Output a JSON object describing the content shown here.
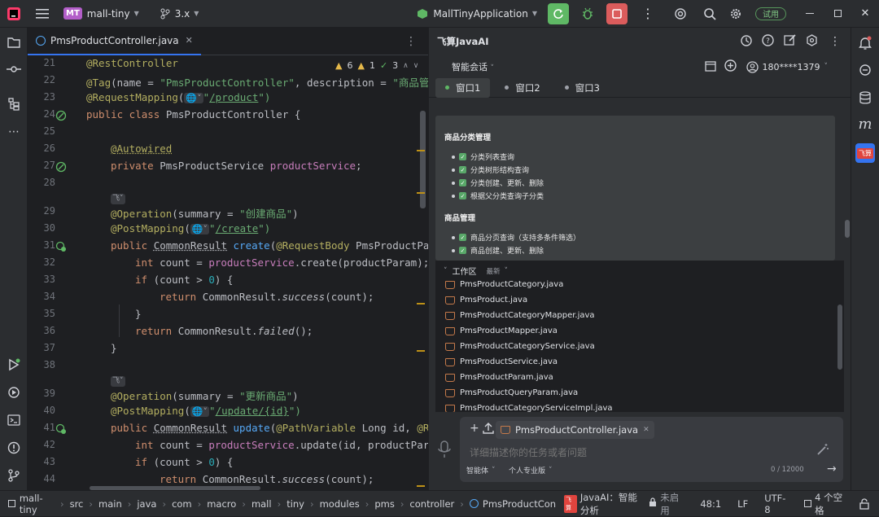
{
  "titlebar": {
    "project_badge": "MT",
    "project_name": "mall-tiny",
    "branch": "3.x",
    "run_config": "MallTinyApplication",
    "trial_label": "试用"
  },
  "editor": {
    "file_tab": "PmsProductController.java",
    "inspections": {
      "warnings": "6",
      "weak": "1",
      "typos": "3"
    },
    "line_numbers": [
      "21",
      "22",
      "23",
      "24",
      "25",
      "26",
      "27",
      "28",
      "",
      "29",
      "30",
      "31",
      "32",
      "33",
      "34",
      "35",
      "36",
      "37",
      "38",
      "",
      "39",
      "40",
      "41",
      "42",
      "43",
      "44"
    ],
    "code": {
      "l21": "@RestController",
      "l22_a": "@Tag",
      "l22_b": "(name = ",
      "l22_c": "\"PmsProductController\"",
      "l22_d": ", description = ",
      "l22_e": "\"商品管",
      "l23_a": "@RequestMapping",
      "l23_b": "(",
      "l23_c": "\"",
      "l23_d": "/product",
      "l23_e": "\")",
      "l24_a": "public class ",
      "l24_b": "PmsProductController {",
      "l26": "@Autowired",
      "l27_a": "private ",
      "l27_b": "PmsProductService ",
      "l27_c": "productService",
      "l27_d": ";",
      "l29_a": "@Operation",
      "l29_b": "(summary = ",
      "l29_c": "\"创建商品\"",
      "l29_d": ")",
      "l30_a": "@PostMapping",
      "l30_b": "(",
      "l30_c": "\"",
      "l30_d": "/create",
      "l30_e": "\")",
      "l31_a": "public ",
      "l31_b": "CommonResult",
      "l31_c": " ",
      "l31_d": "create",
      "l31_e": "(",
      "l31_f": "@RequestBody",
      "l31_g": " PmsProductPa",
      "l32_a": "int ",
      "l32_b": "count = ",
      "l32_c": "productService",
      "l32_d": ".create(productParam);",
      "l33_a": "if ",
      "l33_b": "(count > ",
      "l33_c": "0",
      "l33_d": ") {",
      "l34_a": "return ",
      "l34_b": "CommonResult.",
      "l34_c": "success",
      "l34_d": "(count);",
      "l35": "}",
      "l36_a": "return ",
      "l36_b": "CommonResult.",
      "l36_c": "failed",
      "l36_d": "();",
      "l37": "}",
      "l39_a": "@Operation",
      "l39_b": "(summary = ",
      "l39_c": "\"更新商品\"",
      "l39_d": ")",
      "l40_a": "@PostMapping",
      "l40_b": "(",
      "l40_c": "\"",
      "l40_d": "/update/{id}",
      "l40_e": "\")",
      "l41_a": "public ",
      "l41_b": "CommonResult",
      "l41_c": " ",
      "l41_d": "update",
      "l41_e": "(",
      "l41_f": "@PathVariable",
      "l41_g": " Long id, ",
      "l41_h": "@R",
      "l42_a": "int ",
      "l42_b": "count = ",
      "l42_c": "productService",
      "l42_d": ".update(id, productPar",
      "l43_a": "if ",
      "l43_b": "(count > ",
      "l43_c": "0",
      "l43_d": ") {",
      "l44_a": "return ",
      "l44_b": "CommonResult.",
      "l44_c": "success",
      "l44_d": "(count);"
    }
  },
  "breadcrumbs": [
    "mall-tiny",
    "src",
    "main",
    "java",
    "com",
    "macro",
    "mall",
    "tiny",
    "modules",
    "pms",
    "controller",
    "PmsProductCon"
  ],
  "status": {
    "ai_label": "JavaAI：智能分析",
    "ai_state": "未启用",
    "position": "48:1",
    "line_sep": "LF",
    "encoding": "UTF-8",
    "indent": "4 个空格"
  },
  "ai": {
    "title": "飞算JavaAI",
    "mode": "智能会话",
    "user": "180****1379",
    "tabs": [
      "窗口1",
      "窗口2",
      "窗口3"
    ],
    "sections": [
      {
        "title": "商品分类管理",
        "items": [
          "分类列表查询",
          "分类树形结构查询",
          "分类创建、更新、删除",
          "根据父分类查询子分类"
        ]
      },
      {
        "title": "商品管理",
        "items": [
          "商品分页查询（支持多条件筛选）",
          "商品创建、更新、删除"
        ]
      }
    ],
    "workspace_title": "工作区",
    "workspace_filter": "最新",
    "files": [
      "PmsProductCategory.java",
      "PmsProduct.java",
      "PmsProductCategoryMapper.java",
      "PmsProductMapper.java",
      "PmsProductCategoryService.java",
      "PmsProductService.java",
      "PmsProductParam.java",
      "PmsProductQueryParam.java",
      "PmsProductCategoryServiceImpl.java"
    ],
    "attachment": "PmsProductController.java",
    "input_placeholder": "详细描述你的任务或者问题",
    "agent_mode": "智能体",
    "model": "个人专业版",
    "counter": "0 / 12000"
  },
  "colors": {
    "accent": "#3574f0",
    "run_green": "#5fb865",
    "stop_red": "#db5c5c",
    "trial_green": "#57965c"
  }
}
